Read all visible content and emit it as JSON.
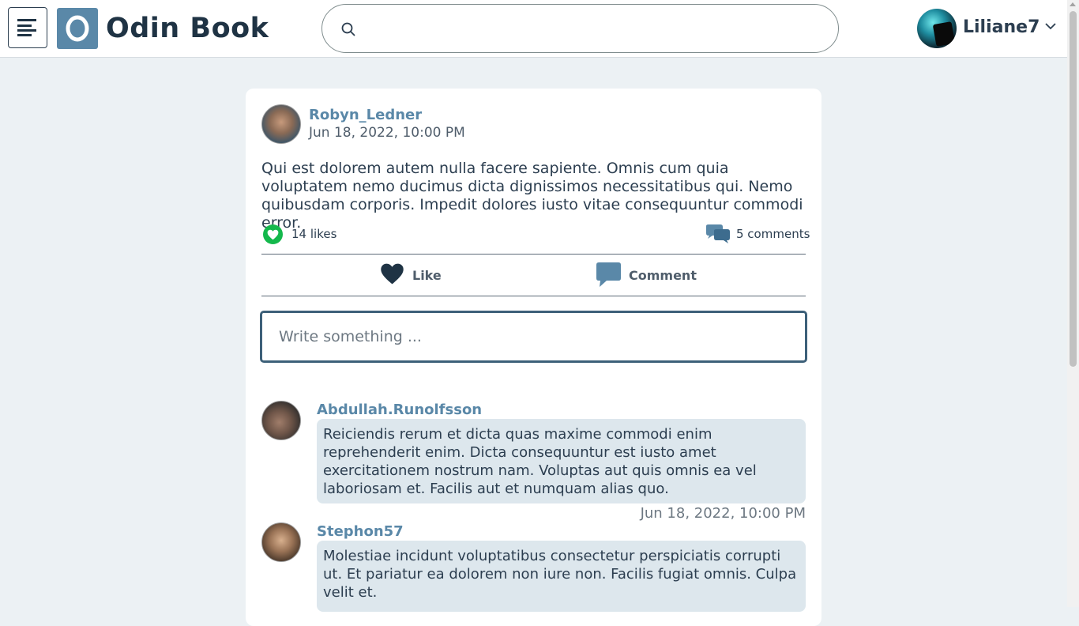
{
  "app": {
    "title": "Odin Book",
    "brand_color": "#5a88a8"
  },
  "header": {
    "menu_icon": "hamburger-menu-icon",
    "logo_icon": "odin-book-logo",
    "search": {
      "value": "",
      "placeholder": "",
      "icon": "search-icon"
    },
    "user": {
      "name": "Liliane7",
      "caret_icon": "chevron-down-icon"
    }
  },
  "post": {
    "author": "Robyn_Ledner",
    "date": "Jun 18, 2022, 10:00 PM",
    "body": "Qui est dolorem autem nulla facere sapiente. Omnis cum quia voluptatem nemo ducimus dicta dignissimos necessitatibus qui. Nemo quibusdam corporis. Impedit dolores iusto vitae consequuntur commodi error.",
    "likes_label": "14 likes",
    "comments_label": "5 comments",
    "actions": {
      "like": "Like",
      "comment": "Comment"
    },
    "write_placeholder": "Write something ...",
    "like_color": "#14b84c"
  },
  "comments": [
    {
      "author": "Abdullah.Runolfsson",
      "text": "Reiciendis rerum et dicta quas maxime commodi enim reprehenderit enim. Dicta consequuntur est iusto amet exercitationem nostrum nam. Voluptas aut quis omnis ea vel laboriosam et. Facilis aut et numquam alias quo.",
      "date": "Jun 18, 2022, 10:00 PM"
    },
    {
      "author": "Stephon57",
      "text": "Molestiae incidunt voluptatibus consectetur perspiciatis corrupti ut. Et pariatur ea dolorem non iure non. Facilis fugiat omnis. Culpa velit et."
    }
  ]
}
